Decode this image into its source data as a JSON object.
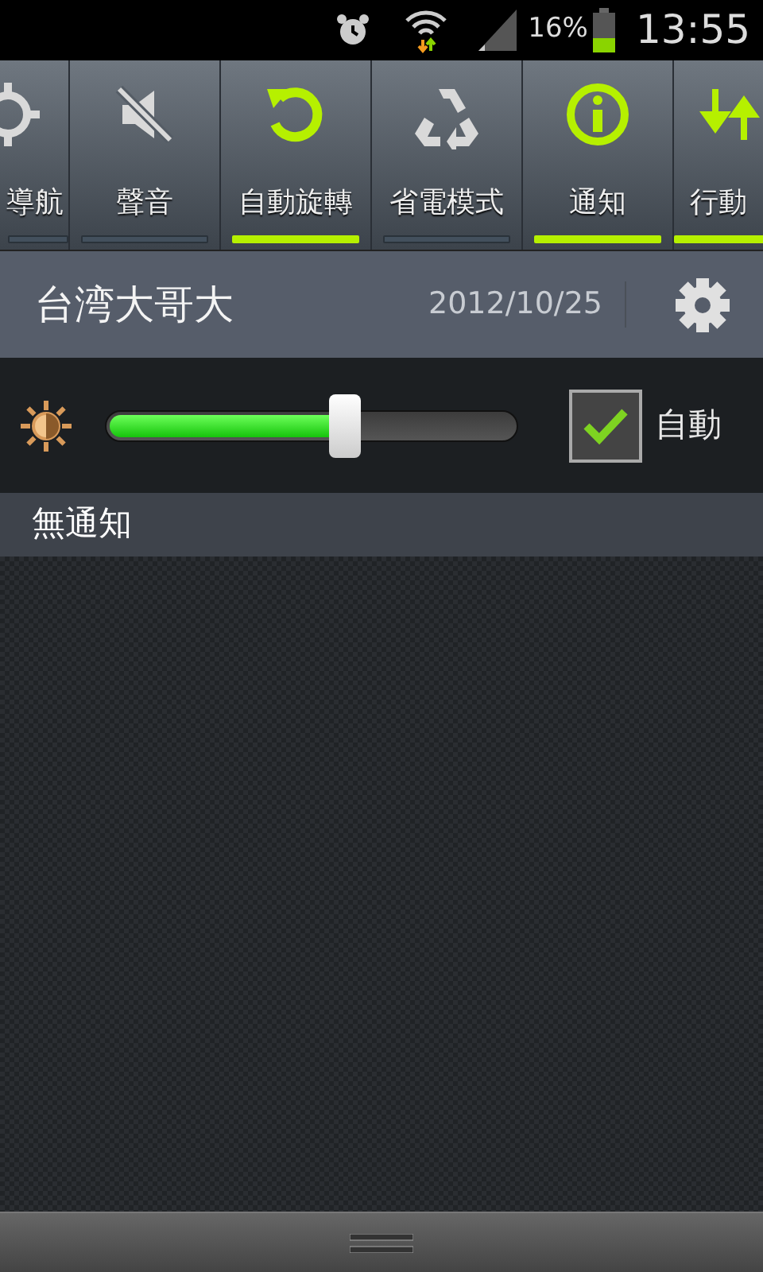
{
  "status_bar": {
    "battery_percent": "16%",
    "time": "13:55"
  },
  "toggles": [
    {
      "kind": "navigation",
      "label": "導航",
      "on": false
    },
    {
      "kind": "sound",
      "label": "聲音",
      "on": false
    },
    {
      "kind": "rotation",
      "label": "自動旋轉",
      "on": true
    },
    {
      "kind": "power_saving",
      "label": "省電模式",
      "on": false
    },
    {
      "kind": "notification",
      "label": "通知",
      "on": true
    },
    {
      "kind": "mobile_data",
      "label": "行動",
      "on": true
    }
  ],
  "header": {
    "carrier": "台湾大哥大",
    "date": "2012/10/25"
  },
  "brightness": {
    "level": 0.58,
    "auto_checked": true,
    "auto_label": "自動"
  },
  "notifications": {
    "heading": "無通知"
  }
}
